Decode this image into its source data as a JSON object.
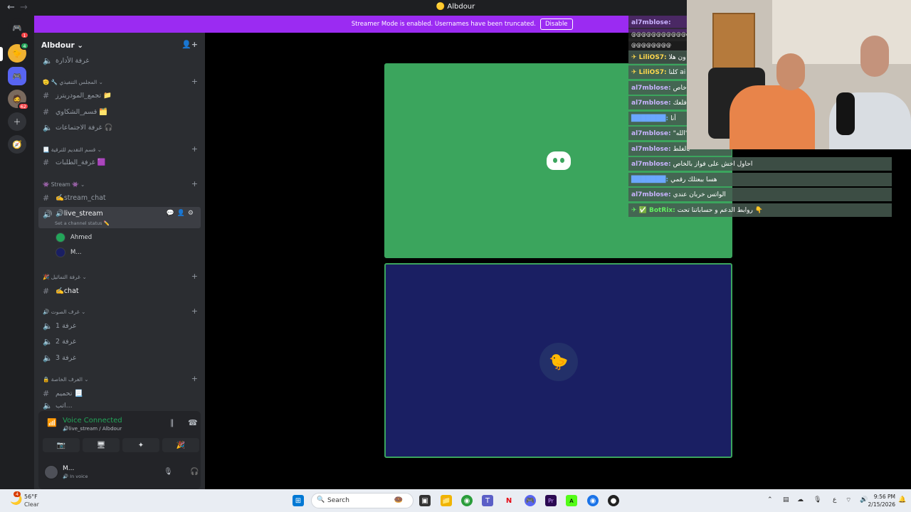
{
  "window": {
    "title": "Albdour",
    "back": "←",
    "forward": "→"
  },
  "banner": {
    "message": "Streamer Mode is enabled. Usernames have been truncated.",
    "button": "Disable"
  },
  "rail": {
    "home_badge": "1",
    "server2_badge": "4",
    "server4_badge": "62"
  },
  "server": {
    "name": "Albdour ⌄"
  },
  "channels": [
    {
      "label": "غرفة الأدارة"
    },
    {
      "label": "تجمع_المودريترز 📁"
    },
    {
      "label": "قسم_الشكاوي 🗂️"
    },
    {
      "label": "غرفة الاجتماعات 🎧"
    },
    {
      "label": "غرفة_الطلبات 🟪"
    },
    {
      "label": "✍️stream_chat"
    },
    {
      "label": "🔊live_stream",
      "status": "Set a channel status ✏️"
    },
    {
      "label": "✍️chat"
    },
    {
      "label": "غرفة 1"
    },
    {
      "label": "غرفة 2"
    },
    {
      "label": "غرفة 3"
    },
    {
      "label": "تحميم 📃"
    },
    {
      "label": "اتب..."
    }
  ],
  "categories": [
    {
      "label": "🫡 🔧 المجلس التنفيذي ⌄"
    },
    {
      "label": "📃 قسم التقديم للترقية ⌄"
    },
    {
      "label": "👾 Stream 👾 ⌄"
    },
    {
      "label": "🎉 غرفة التماثيل ⌄"
    },
    {
      "label": "🔊 غرف الصوت ⌄"
    },
    {
      "label": "🔒 الغرف الخاصة ⌄"
    }
  ],
  "voice_users": [
    {
      "name": "Ahmed"
    },
    {
      "name": "M..."
    }
  ],
  "voice": {
    "status": "Voice Connected",
    "location": "🔊live_stream / Albdour"
  },
  "user": {
    "name": "M...",
    "status": "🔊 In voice"
  },
  "chat": [
    {
      "user": "al7mblose:",
      "text": "@@@@@@@@@@@@@@@"
    },
    {
      "user": "",
      "text": "@@@@@@@@"
    },
    {
      "user": "✈ LiliOS7:",
      "text": "ون هلا"
    },
    {
      "user": "✈ LiliOS7:",
      "text": "كلنا ai"
    },
    {
      "user": "al7mblose:",
      "text": "خاص"
    },
    {
      "user": "al7mblose:",
      "text": "فلعك"
    },
    {
      "user": "███████:",
      "text": "أنا"
    },
    {
      "user": "al7mblose:",
      "text": "\"الله\""
    },
    {
      "user": "al7mblose:",
      "text": "بالغلط"
    },
    {
      "user": "al7mblose:",
      "text": "احاول اخش على فواز بالخاص"
    },
    {
      "user": "███████:",
      "text": "هسا ببعتلك رقمي"
    },
    {
      "user": "al7mblose:",
      "text": "الواتس خربان عندي"
    },
    {
      "user": "✈ ✅ BotRix:",
      "text": "روابط الدعم و حساباتنا تحت 👇"
    }
  ],
  "taskbar": {
    "weather_temp": "56°F",
    "weather_desc": "Clear",
    "weather_badge": "4",
    "search": "Search",
    "time": "9:56 PM",
    "date": "2/15/2026",
    "lang": "ع"
  }
}
